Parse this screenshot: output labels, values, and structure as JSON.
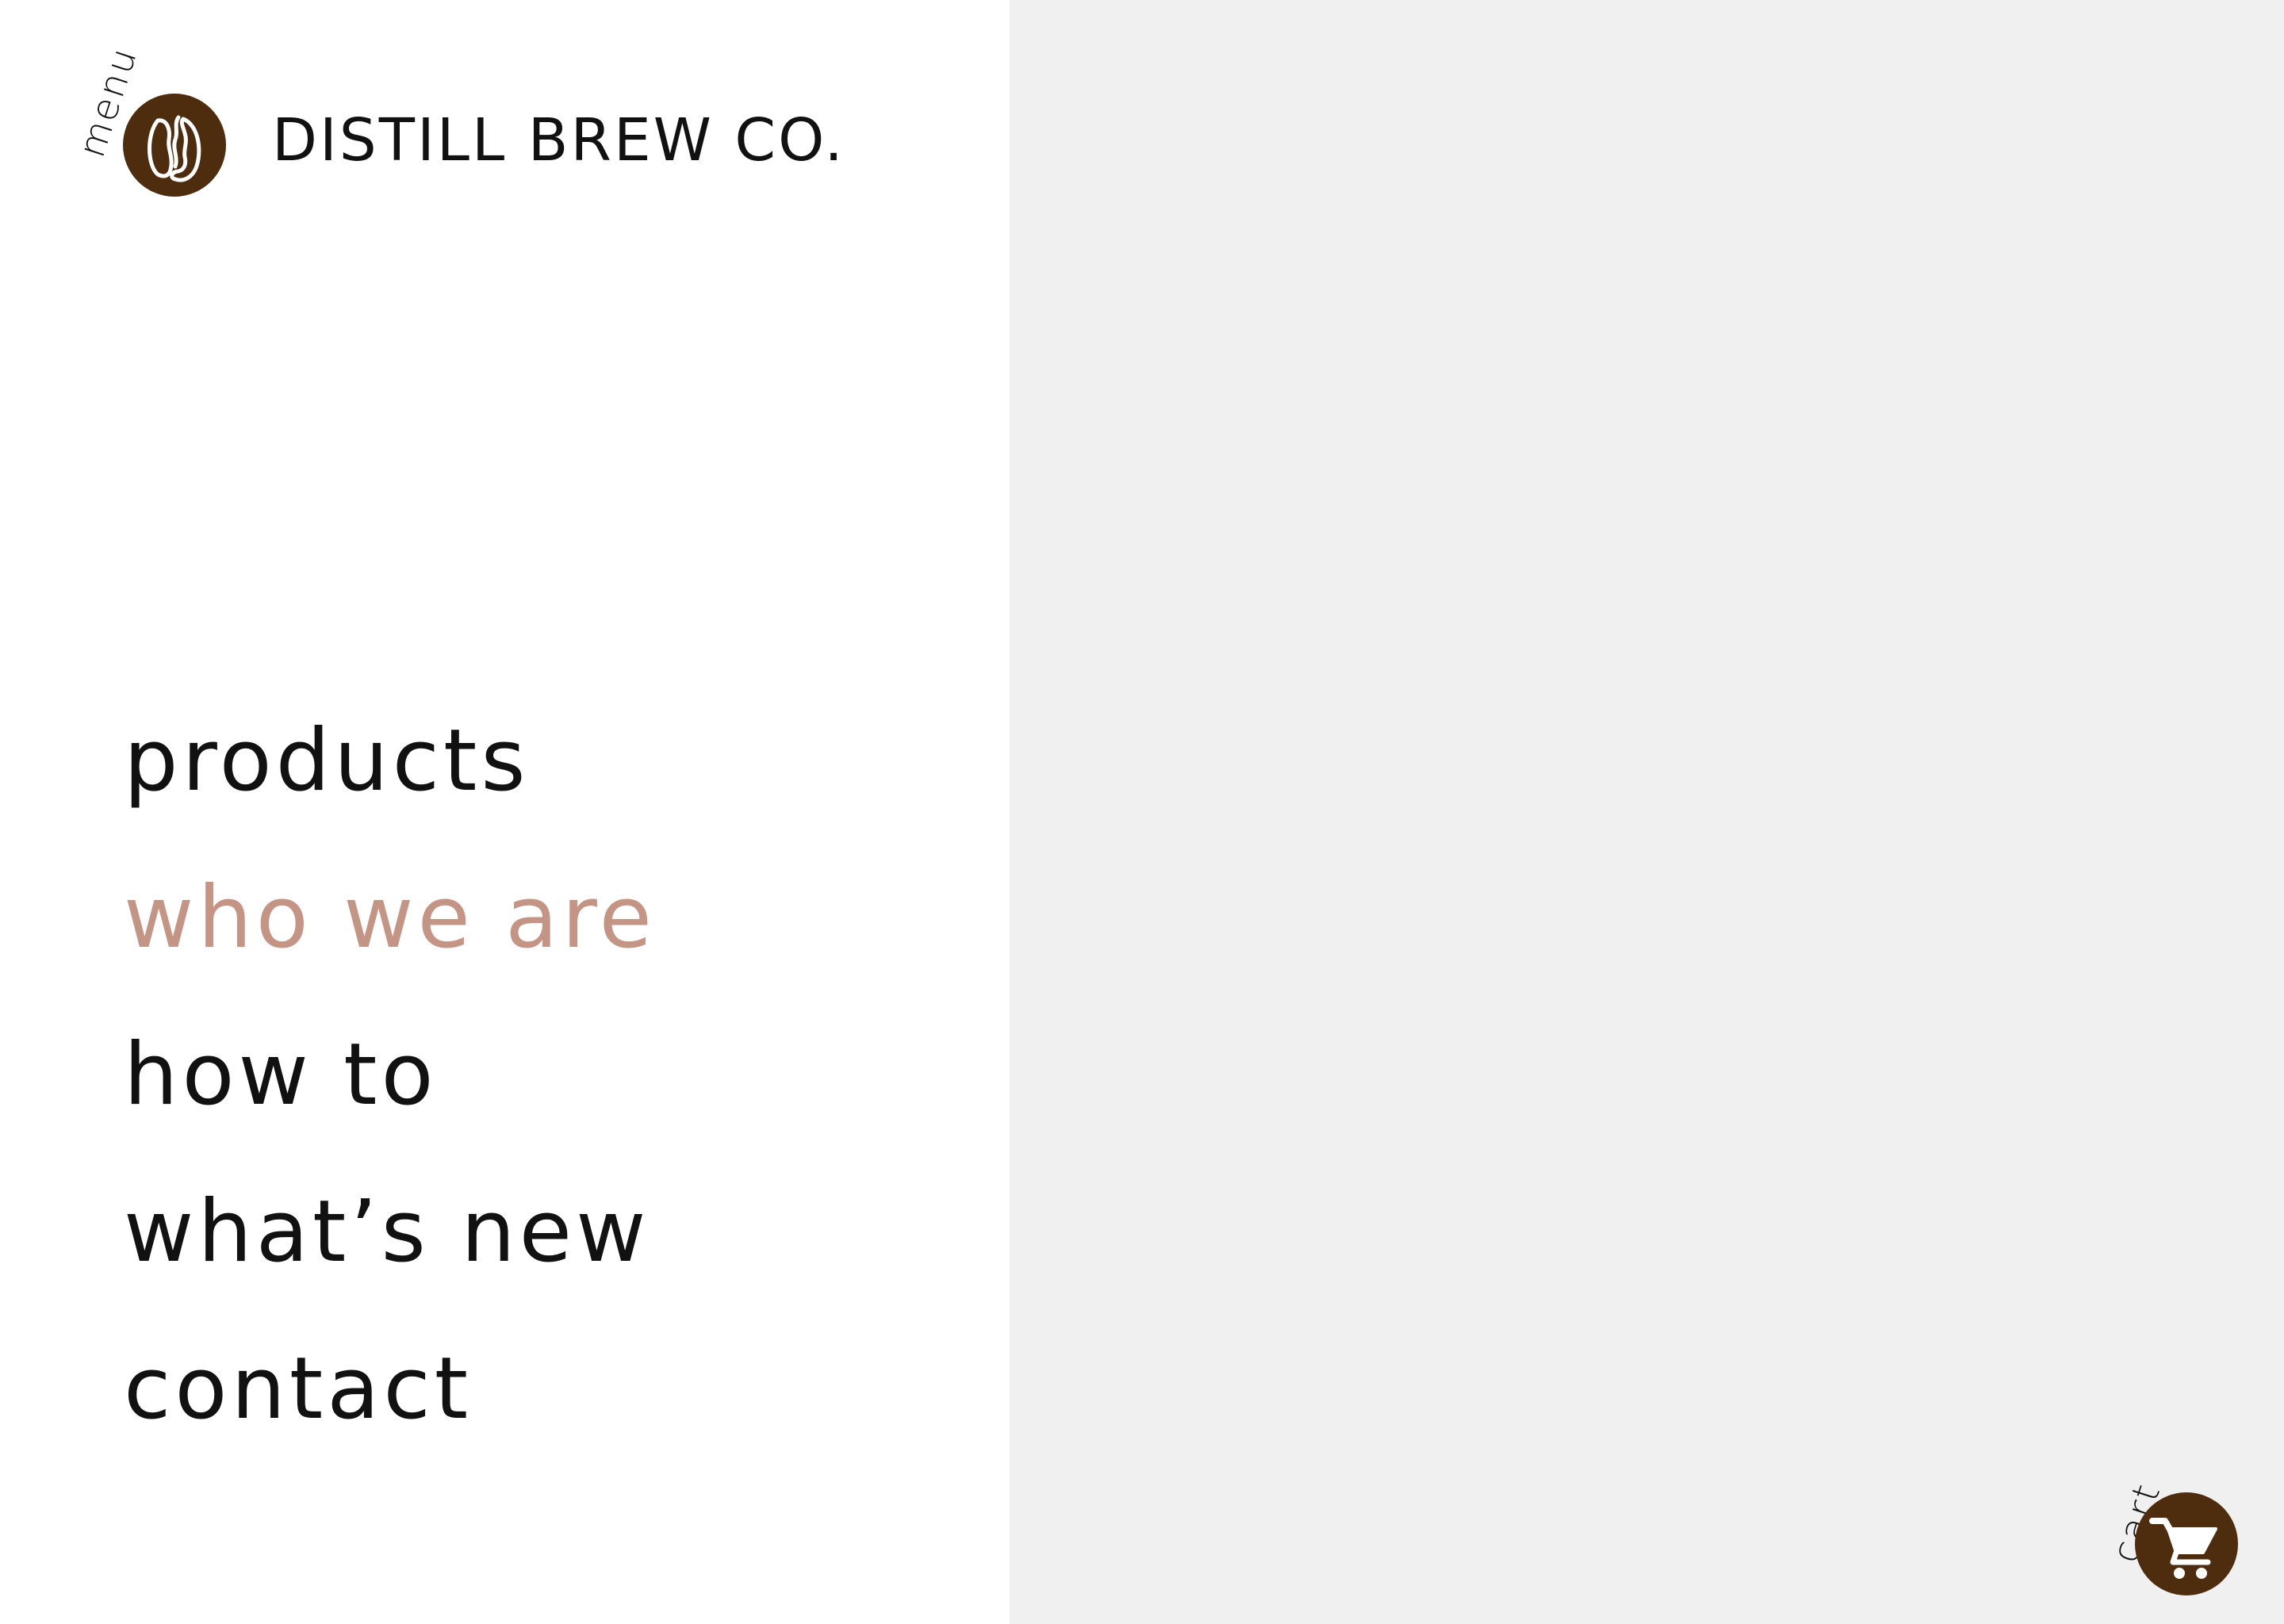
{
  "header": {
    "menu_label": "menu",
    "brand_name": "DISTILL BREW CO.",
    "logo_icon": "coffee-bean-icon"
  },
  "nav": {
    "items": [
      {
        "label": "products",
        "active": false
      },
      {
        "label": "who we are",
        "active": true
      },
      {
        "label": "how to",
        "active": false
      },
      {
        "label": "what’s new",
        "active": false
      },
      {
        "label": "contact",
        "active": false
      }
    ]
  },
  "cart": {
    "label": "cart",
    "icon": "shopping-cart-icon"
  },
  "colors": {
    "brand_brown": "#4e2c0e",
    "active_link": "#c49585",
    "text": "#111111",
    "content_background": "#f0f0f0",
    "menu_background": "#ffffff"
  }
}
